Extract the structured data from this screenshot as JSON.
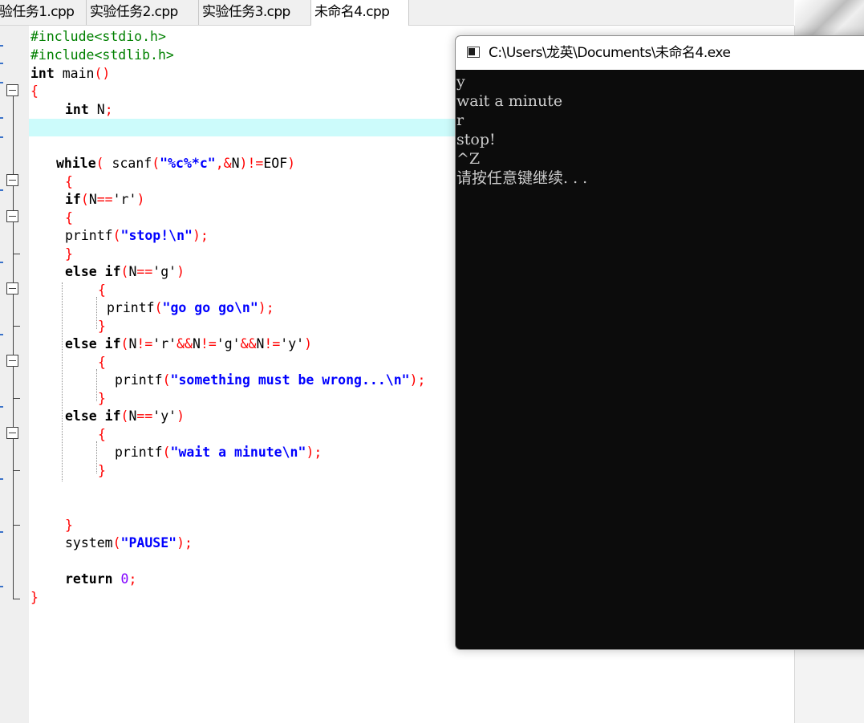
{
  "tabs": [
    {
      "label": "验任务1.cpp",
      "active": false
    },
    {
      "label": "实验任务2.cpp",
      "active": false
    },
    {
      "label": "实验任务3.cpp",
      "active": false
    },
    {
      "label": "未命名4.cpp",
      "active": true
    }
  ],
  "editor": {
    "lines": {
      "l1": {
        "pp": "#include<stdio.h>"
      },
      "l2": {
        "pp": "#include<stdlib.h>"
      },
      "l3": {
        "kw": "int",
        "id": " main",
        "sym": "()"
      },
      "l4": {
        "sym": "{"
      },
      "l5": {
        "kw": "int",
        "id": " N",
        "sym": ";"
      },
      "l8": {
        "kw1": "while",
        "sym1": "( ",
        "id1": "scanf",
        "sym2": "(",
        "str": "\"%c%*c\"",
        "sym3": ",&",
        "id2": "N",
        "sym4": ")!=",
        "id3": "EOF",
        "sym5": ")"
      },
      "l9": {
        "sym": "{"
      },
      "l10": {
        "kw": "if",
        "sym1": "(",
        "id": "N",
        "sym2": "==",
        "chr": "'r'",
        "sym3": ")"
      },
      "l11": {
        "sym": "{"
      },
      "l12": {
        "id": "printf",
        "sym1": "(",
        "str": "\"stop!\\n\"",
        "sym2": ");"
      },
      "l13": {
        "sym": "}"
      },
      "l14": {
        "kw": "else if",
        "sym1": "(",
        "id": "N",
        "sym2": "==",
        "chr": "'g'",
        "sym3": ")"
      },
      "l15": {
        "sym": "{"
      },
      "l16": {
        "id": "printf",
        "sym1": "(",
        "str": "\"go go go\\n\"",
        "sym2": ");"
      },
      "l17": {
        "sym": "}"
      },
      "l18": {
        "kw": "else if",
        "sym1": "(",
        "id1": "N",
        "sym2": "!=",
        "chr1": "'r'",
        "sym3": "&&",
        "id2": "N",
        "sym4": "!=",
        "chr2": "'g'",
        "sym5": "&&",
        "id3": "N",
        "sym6": "!=",
        "chr3": "'y'",
        "sym7": ")"
      },
      "l19": {
        "sym": "{"
      },
      "l20": {
        "id": "printf",
        "sym1": "(",
        "str": "\"something must be wrong...\\n\"",
        "sym2": ");"
      },
      "l21": {
        "sym": "}"
      },
      "l22": {
        "kw": "else if",
        "sym1": "(",
        "id": "N",
        "sym2": "==",
        "chr": "'y'",
        "sym3": ")"
      },
      "l23": {
        "sym": "{"
      },
      "l24": {
        "id": "printf",
        "sym1": "(",
        "str": "\"wait a minute\\n\"",
        "sym2": ");"
      },
      "l25": {
        "sym": "}"
      },
      "l28": {
        "sym": "}"
      },
      "l29": {
        "id": "system",
        "sym1": "(",
        "str": "\"PAUSE\"",
        "sym2": ");"
      },
      "l31": {
        "kw": "return",
        "num": " 0",
        "sym": ";"
      },
      "l32": {
        "sym": "}"
      }
    }
  },
  "console": {
    "title": "C:\\Users\\龙英\\Documents\\未命名4.exe",
    "output": [
      "y",
      "wait a minute",
      "r",
      "stop!",
      "^Z",
      "请按任意键继续. . ."
    ]
  },
  "colors": {
    "keyword": "#000000",
    "preprocessor": "#008000",
    "symbol": "#ff0000",
    "string": "#0000ff",
    "number": "#8000ff",
    "current_line": "#ccfbfb",
    "console_bg": "#0c0c0c",
    "console_fg": "#cccccc"
  },
  "icons": {
    "console_window": "console-window-icon",
    "fold_marker": "fold-minus-icon"
  }
}
